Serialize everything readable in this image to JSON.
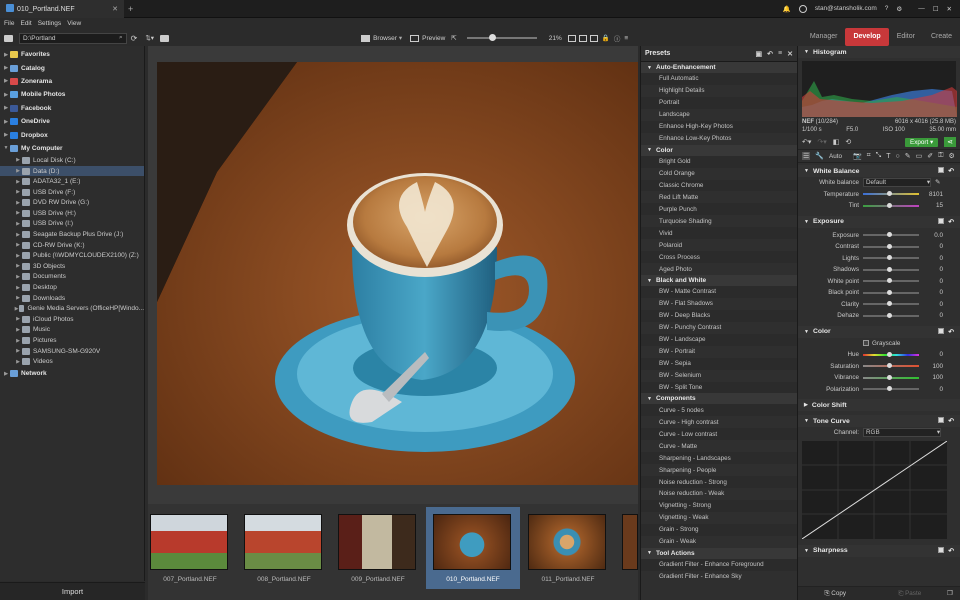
{
  "window": {
    "tab_title": "010_Portland.NEF",
    "user_email": "stan@stansholik.com"
  },
  "menu": [
    "File",
    "Edit",
    "Settings",
    "View"
  ],
  "modes": {
    "manager": "Manager",
    "develop": "Develop",
    "editor": "Editor",
    "create": "Create"
  },
  "toolbar": {
    "path": "D:\\Portland",
    "browser": "Browser",
    "preview": "Preview",
    "zoom": "21%"
  },
  "tree": [
    {
      "label": "Favorites",
      "level": 0
    },
    {
      "label": "Catalog",
      "level": 0
    },
    {
      "label": "Zonerama",
      "level": 0
    },
    {
      "label": "Mobile Photos",
      "level": 0
    },
    {
      "label": "Facebook",
      "level": 0
    },
    {
      "label": "OneDrive",
      "level": 0
    },
    {
      "label": "Dropbox",
      "level": 0
    },
    {
      "label": "My Computer",
      "level": 0
    },
    {
      "label": "Local Disk (C:)",
      "level": 1
    },
    {
      "label": "Data (D:)",
      "level": 1,
      "selected": true
    },
    {
      "label": "ADATA32_1 (E:)",
      "level": 1
    },
    {
      "label": "USB Drive (F:)",
      "level": 1
    },
    {
      "label": "DVD RW Drive (G:)",
      "level": 1
    },
    {
      "label": "USB Drive (H:)",
      "level": 1
    },
    {
      "label": "USB Drive (I:)",
      "level": 1
    },
    {
      "label": "Seagate Backup Plus Drive (J:)",
      "level": 1
    },
    {
      "label": "CD-RW Drive (K:)",
      "level": 1
    },
    {
      "label": "Public (\\\\WDMYCLOUDEX2100) (Z:)",
      "level": 1
    },
    {
      "label": "3D Objects",
      "level": 1
    },
    {
      "label": "Documents",
      "level": 1
    },
    {
      "label": "Desktop",
      "level": 1
    },
    {
      "label": "Downloads",
      "level": 1
    },
    {
      "label": "Genie Media Servers (OfficeHP[Windo...",
      "level": 1
    },
    {
      "label": "iCloud Photos",
      "level": 1
    },
    {
      "label": "Music",
      "level": 1
    },
    {
      "label": "Pictures",
      "level": 1
    },
    {
      "label": "SAMSUNG-SM-G920V",
      "level": 1
    },
    {
      "label": "Videos",
      "level": 1
    },
    {
      "label": "Network",
      "level": 0
    }
  ],
  "import_label": "Import",
  "filmstrip": [
    "007_Portland.NEF",
    "008_Portland.NEF",
    "009_Portland.NEF",
    "010_Portland.NEF",
    "011_Portland.NEF"
  ],
  "presets": {
    "title": "Presets",
    "groups": [
      {
        "name": "Auto-Enhancement",
        "items": [
          "Full Automatic",
          "Highlight Details",
          "Portrait",
          "Landscape",
          "Enhance High-Key Photos",
          "Enhance Low-Key Photos"
        ]
      },
      {
        "name": "Color",
        "items": [
          "Bright Gold",
          "Cold Orange",
          "Classic Chrome",
          "Red Lift Matte",
          "Purple Punch",
          "Turquoise Shading",
          "Vivid",
          "Polaroid",
          "Cross Process",
          "Aged Photo"
        ]
      },
      {
        "name": "Black and White",
        "items": [
          "BW - Matte Contrast",
          "BW - Flat Shadows",
          "BW - Deep Blacks",
          "BW - Punchy Contrast",
          "BW - Landscape",
          "BW - Portrait",
          "BW - Sepia",
          "BW - Selenium",
          "BW - Split Tone"
        ]
      },
      {
        "name": "Components",
        "items": [
          "Curve - 5 nodes",
          "Curve - High contrast",
          "Curve - Low contrast",
          "Curve - Matte",
          "Sharpening - Landscapes",
          "Sharpening - People",
          "Noise reduction - Strong",
          "Noise reduction - Weak",
          "Vignetting - Strong",
          "Vignetting - Weak",
          "Grain - Strong",
          "Grain - Weak"
        ]
      },
      {
        "name": "Tool Actions",
        "items": [
          "Gradient Filter - Enhance Foreground",
          "Gradient Filter - Enhance Sky"
        ]
      }
    ]
  },
  "histogram": {
    "title": "Histogram",
    "format": "NEF",
    "index": "(10/284)",
    "dims": "6016 x 4016 (25.8 MB)",
    "shutter": "1/100 s",
    "aperture": "F5.0",
    "iso": "ISO 100",
    "focal": "35.00 mm"
  },
  "export_label": "Export",
  "auto_label": "Auto",
  "white_balance": {
    "title": "White Balance",
    "wb_label": "White balance",
    "wb_value": "Default",
    "temperature": {
      "label": "Temperature",
      "value": "8101"
    },
    "tint": {
      "label": "Tint",
      "value": "15"
    }
  },
  "exposure": {
    "title": "Exposure",
    "sliders": [
      {
        "label": "Exposure",
        "value": "0.0"
      },
      {
        "label": "Contrast",
        "value": "0"
      },
      {
        "label": "Lights",
        "value": "0"
      },
      {
        "label": "Shadows",
        "value": "0"
      },
      {
        "label": "White point",
        "value": "0"
      },
      {
        "label": "Black point",
        "value": "0"
      },
      {
        "label": "Clarity",
        "value": "0"
      },
      {
        "label": "Dehaze",
        "value": "0"
      }
    ]
  },
  "color": {
    "title": "Color",
    "grayscale": "Grayscale",
    "sliders": [
      {
        "label": "Hue",
        "value": "0"
      },
      {
        "label": "Saturation",
        "value": "100"
      },
      {
        "label": "Vibrance",
        "value": "100"
      },
      {
        "label": "Polarization",
        "value": "0"
      }
    ]
  },
  "color_shift": "Color Shift",
  "tone_curve": {
    "title": "Tone Curve",
    "channel_label": "Channel:",
    "channel_value": "RGB"
  },
  "sharpness": "Sharpness",
  "copy_label": "Copy",
  "paste_label": "Paste"
}
